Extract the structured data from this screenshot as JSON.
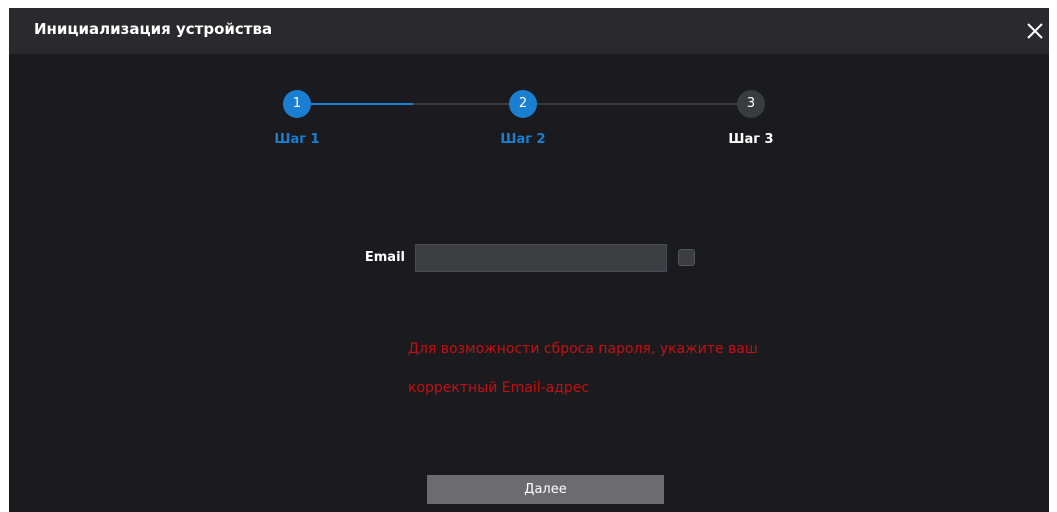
{
  "dialog": {
    "title": "Инициализация устройства",
    "close_icon": "close-icon"
  },
  "stepper": {
    "current_step": 2,
    "steps": [
      {
        "number": "1",
        "label": "Шаг 1",
        "state": "done"
      },
      {
        "number": "2",
        "label": "Шаг 2",
        "state": "active"
      },
      {
        "number": "3",
        "label": "Шаг 3",
        "state": "pending"
      }
    ]
  },
  "form": {
    "email_label": "Email",
    "email_value": "",
    "email_placeholder": "",
    "show_checkbox_checked": false
  },
  "hint": {
    "line1": "Для возможности сброса пароля, укажите ваш",
    "line2": "корректный Email-адрес"
  },
  "footer": {
    "next_label": "Далее"
  },
  "colors": {
    "background": "#1b1b1f",
    "header": "#2a2a2e",
    "accent": "#1a7fd1",
    "pending": "#3a3b3f",
    "hint": "#c40f12",
    "button": "#6c6c6e"
  }
}
